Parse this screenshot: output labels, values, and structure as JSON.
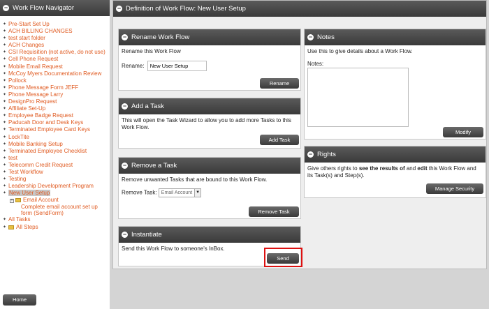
{
  "sidebar": {
    "title": "Work Flow Navigator",
    "items": [
      "Pre-Start Set Up",
      "ACH BILLING CHANGES",
      "test start folder",
      "ACH Changes",
      "CSI Requisition (not active, do not use)",
      "Cell Phone Request",
      "Mobile Email Request",
      "McCoy Myers Documentation Review",
      "Pollock",
      "Phone Message Form JEFF",
      "Phone Message Larry",
      "DesignPro Request",
      "Affiliate Set-Up",
      "Employee Badge Request",
      "Paducah Door and Desk Keys",
      "Terminated Employee Card Keys",
      "LockTite",
      "Mobile Banking Setup",
      "Terminated Employee Checklist",
      "test",
      "Telecomm Credit Request",
      "Test Workflow",
      "Testing",
      "Leadership Development Program"
    ],
    "selected_item": "New User Setup",
    "task_folder": "Email Account",
    "step": "Complete email account set up form (SendForm)",
    "all_tasks": "All Tasks",
    "all_steps": "All Steps",
    "home_label": "Home"
  },
  "main": {
    "title": "Definition of Work Flow: New User Setup",
    "rename": {
      "title": "Rename Work Flow",
      "desc": "Rename this Work Flow",
      "label": "Rename:",
      "value": "New User Setup",
      "button": "Rename"
    },
    "add_task": {
      "title": "Add a Task",
      "desc": "This will open the Task Wizard to allow you to add more Tasks to this Work Flow.",
      "button": "Add Task"
    },
    "remove_task": {
      "title": "Remove a Task",
      "desc": "Remove unwanted Tasks that are bound to this Work Flow.",
      "label": "Remove Task:",
      "selected": "Email Account",
      "button": "Remove Task"
    },
    "instantiate": {
      "title": "Instantiate",
      "desc": "Send this Work Flow to someone's InBox.",
      "button": "Send"
    },
    "notes": {
      "title": "Notes",
      "desc": "Use this to give details about a Work Flow.",
      "label": "Notes:",
      "button": "Modify"
    },
    "rights": {
      "title": "Rights",
      "desc_pre": "Give others rights to ",
      "desc_b1": "see the results of",
      "desc_mid": " and ",
      "desc_b2": "edit",
      "desc_post": " this Work Flow and its Task(s) and Step(s).",
      "button": "Manage Security"
    }
  }
}
